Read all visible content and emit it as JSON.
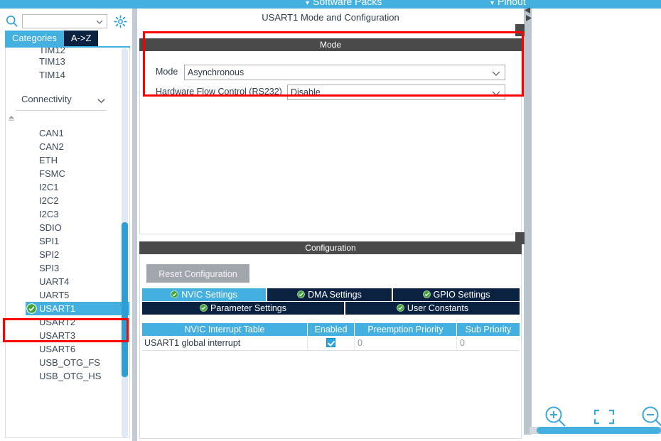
{
  "topbar": {
    "software_packs": "Software Packs",
    "pinout": "Pinout",
    "caret": "▾"
  },
  "sidebar": {
    "search": {
      "value": "",
      "placeholder": ""
    },
    "icons": {
      "search": "search-icon",
      "gear": "gear-icon",
      "chevron": "chevron-down-icon"
    },
    "tabs": [
      {
        "label": "Categories",
        "active": true
      },
      {
        "label": "A->Z",
        "active": false
      }
    ],
    "top_items": [
      "TIM12",
      "TIM13",
      "TIM14"
    ],
    "group": {
      "label": "Connectivity",
      "expanded": true
    },
    "items": [
      {
        "label": "CAN1",
        "selected": false,
        "configured": false
      },
      {
        "label": "CAN2",
        "selected": false,
        "configured": false
      },
      {
        "label": "ETH",
        "selected": false,
        "configured": false
      },
      {
        "label": "FSMC",
        "selected": false,
        "configured": false
      },
      {
        "label": "I2C1",
        "selected": false,
        "configured": false
      },
      {
        "label": "I2C2",
        "selected": false,
        "configured": false
      },
      {
        "label": "I2C3",
        "selected": false,
        "configured": false
      },
      {
        "label": "SDIO",
        "selected": false,
        "configured": false
      },
      {
        "label": "SPI1",
        "selected": false,
        "configured": false
      },
      {
        "label": "SPI2",
        "selected": false,
        "configured": false
      },
      {
        "label": "SPI3",
        "selected": false,
        "configured": false
      },
      {
        "label": "UART4",
        "selected": false,
        "configured": false
      },
      {
        "label": "UART5",
        "selected": false,
        "configured": false
      },
      {
        "label": "USART1",
        "selected": true,
        "configured": true
      },
      {
        "label": "USART2",
        "selected": false,
        "configured": false
      },
      {
        "label": "USART3",
        "selected": false,
        "configured": false
      },
      {
        "label": "USART6",
        "selected": false,
        "configured": false
      },
      {
        "label": "USB_OTG_FS",
        "selected": false,
        "configured": false
      },
      {
        "label": "USB_OTG_HS",
        "selected": false,
        "configured": false
      }
    ]
  },
  "main": {
    "title": "USART1 Mode and Configuration",
    "mode_section": {
      "header": "Mode",
      "fields": [
        {
          "label": "Mode",
          "value": "Asynchronous"
        },
        {
          "label": "Hardware Flow Control (RS232)",
          "value": "Disable"
        }
      ]
    },
    "config_section": {
      "header": "Configuration",
      "reset_label": "Reset Configuration",
      "tabs_row1": [
        {
          "label": "NVIC Settings",
          "active": true
        },
        {
          "label": "DMA Settings",
          "active": false
        },
        {
          "label": "GPIO Settings",
          "active": false
        }
      ],
      "tabs_row2": [
        {
          "label": "Parameter Settings",
          "active": false
        },
        {
          "label": "User Constants",
          "active": false
        }
      ],
      "table": {
        "columns": [
          "NVIC Interrupt Table",
          "Enabled",
          "Preemption Priority",
          "Sub Priority"
        ],
        "rows": [
          {
            "name": "USART1 global interrupt",
            "enabled": true,
            "preemption": "0",
            "sub": "0"
          }
        ]
      }
    }
  },
  "canvas": {
    "zoom_in": "zoom-in-icon",
    "zoom_fit": "zoom-fit-icon",
    "zoom_out": "zoom-out-icon"
  },
  "colors": {
    "accent_blue": "#44b0df",
    "dark_navy": "#0a2240",
    "section_gray": "#4a4a4a",
    "highlight_red": "#fe0000",
    "check_green": "#3fa535"
  }
}
